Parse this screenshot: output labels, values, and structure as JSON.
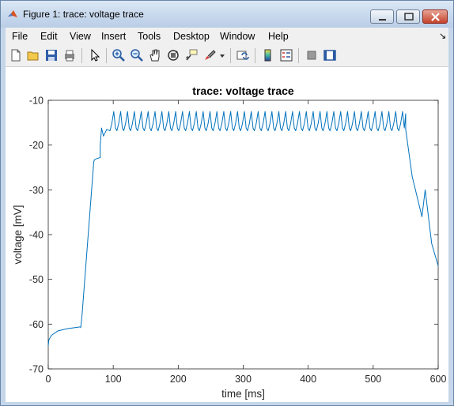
{
  "window": {
    "title": "Figure 1: trace: voltage trace"
  },
  "menu": [
    {
      "label": "File",
      "key": "file"
    },
    {
      "label": "Edit",
      "key": "edit"
    },
    {
      "label": "View",
      "key": "view"
    },
    {
      "label": "Insert",
      "key": "insert"
    },
    {
      "label": "Tools",
      "key": "tools"
    },
    {
      "label": "Desktop",
      "key": "desktop"
    },
    {
      "label": "Window",
      "key": "window"
    },
    {
      "label": "Help",
      "key": "help"
    }
  ],
  "toolbar": [
    {
      "icon": "new-figure-icon"
    },
    {
      "icon": "open-file-icon"
    },
    {
      "icon": "save-icon"
    },
    {
      "icon": "print-icon"
    },
    {
      "icon": "edit-plot-arrow-icon"
    },
    {
      "icon": "zoom-in-icon"
    },
    {
      "icon": "zoom-out-icon"
    },
    {
      "icon": "pan-hand-icon"
    },
    {
      "icon": "rotate-3d-icon"
    },
    {
      "icon": "data-cursor-icon"
    },
    {
      "icon": "brush-icon"
    },
    {
      "icon": "link-plot-icon"
    },
    {
      "icon": "insert-colorbar-icon"
    },
    {
      "icon": "insert-legend-icon"
    },
    {
      "icon": "hide-plot-tools-icon"
    },
    {
      "icon": "show-plot-tools-icon"
    }
  ],
  "colors": {
    "line": "#0072BD",
    "axes": "#262626",
    "grid": "none"
  },
  "chart_data": {
    "type": "line",
    "title": "trace: voltage trace",
    "xlabel": "time [ms]",
    "ylabel": "voltage [mV]",
    "xlim": [
      0,
      600
    ],
    "ylim": [
      -70,
      -10
    ],
    "xticks": [
      0,
      100,
      200,
      300,
      400,
      500,
      600
    ],
    "yticks": [
      -70,
      -60,
      -50,
      -40,
      -30,
      -20,
      -10
    ],
    "grid": false,
    "legend": "none",
    "description_of_series": "single trace",
    "series": [
      {
        "color": "#0072BD",
        "x": [
          0,
          1,
          5,
          15,
          30,
          50,
          50,
          52,
          70,
          71,
          72,
          75,
          80,
          80,
          82,
          85,
          90,
          95,
          550,
          550,
          560,
          570,
          575,
          580,
          590,
          600
        ],
        "y": [
          -64.8,
          -63.5,
          -62.5,
          -61.5,
          -61,
          -60.6,
          -60.8,
          -58,
          -23.8,
          -23.3,
          -23.2,
          -23.0,
          -22.8,
          -20,
          -16.2,
          -18,
          -16.5,
          -13,
          -13,
          -16.5,
          -27,
          -33,
          -36,
          -30,
          -42,
          -47
        ]
      }
    ],
    "spikes": {
      "start_ms": 85,
      "end_ms": 550,
      "count": 43,
      "peak_mV": -12.5,
      "trough_mV": -16.8
    }
  }
}
